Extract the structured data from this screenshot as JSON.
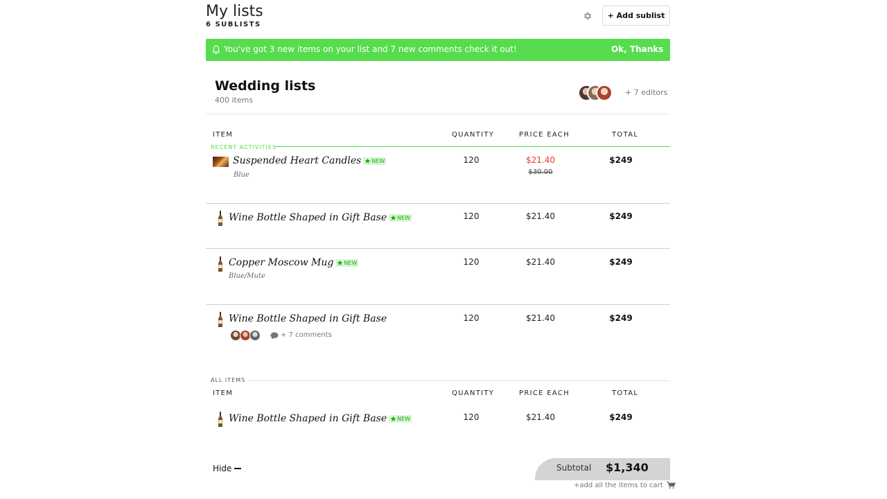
{
  "header": {
    "title": "My lists",
    "sublist_count": "6 SUBLISTS",
    "add_button": "+ Add sublist"
  },
  "notification": {
    "message": "You've got 3 new items on your list and 7 new comments check it out!",
    "action": "Ok, Thanks",
    "color": "#56dc4d"
  },
  "list": {
    "title": "Wedding lists",
    "count": "400 items",
    "editors_text": "+ 7 editors"
  },
  "columns": {
    "item": "ITEM",
    "quantity": "QUANTITY",
    "price": "PRICE EACH",
    "total": "TOTAL"
  },
  "recent": {
    "label": "RECENT ACTIVITIES",
    "badge": "NEW",
    "items": [
      {
        "name": "Suspended Heart Candles",
        "variant": "Blue",
        "quantity": "120",
        "price": "$21.40",
        "old_price": "$30.00",
        "total": "$249"
      },
      {
        "name": "Wine Bottle Shaped in Gift Base",
        "quantity": "120",
        "price": "$21.40",
        "total": "$249"
      },
      {
        "name": "Copper Moscow Mug",
        "variant": "Blue/Mute",
        "quantity": "120",
        "price": "$21.40",
        "total": "$249"
      },
      {
        "name": "Wine Bottle Shaped in Gift Base",
        "quantity": "120",
        "price": "$21.40",
        "total": "$249",
        "comments": "+ 7 comments"
      }
    ]
  },
  "all_items": {
    "label": "ALL ITEMS",
    "items": [
      {
        "name": "Wine Bottle Shaped in Gift Base",
        "quantity": "120",
        "price": "$21.40",
        "total": "$249"
      }
    ]
  },
  "footer": {
    "hide": "Hide",
    "subtotal_label": "Subtotal",
    "subtotal_value": "$1,340",
    "cart_link": "+add all the items to cart"
  },
  "colors": {
    "accent": "#56dc4d",
    "sale": "#e53b2c",
    "badge_bg": "#d8f7d3"
  }
}
